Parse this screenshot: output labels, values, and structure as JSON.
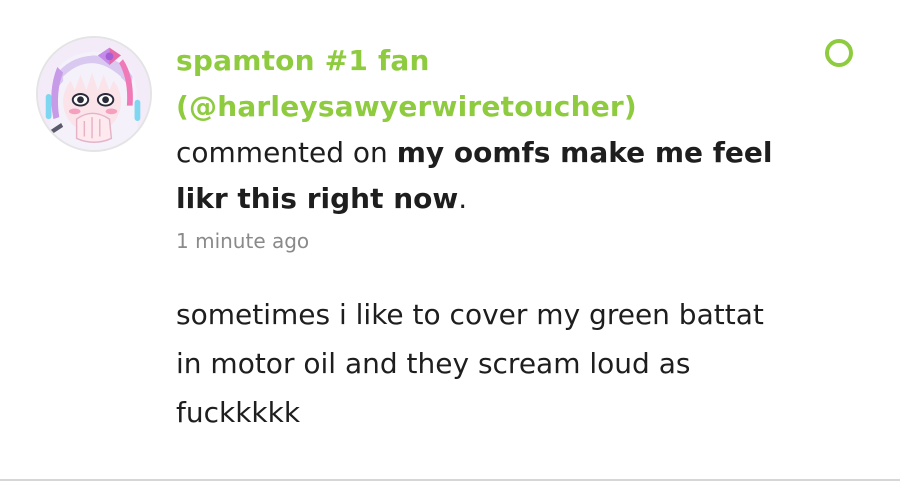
{
  "notification": {
    "author_name": "spamton #1 fan",
    "author_handle": "(@harleysawyerwiretoucher)",
    "action_verb": "commented on",
    "post_title": "my oomfs make me feel likr this right now",
    "period": ".",
    "timestamp": "1 minute ago",
    "comment_body": "sometimes i like to cover my green battat in motor oil and they scream loud as fuckkkkk",
    "unread": true
  },
  "colors": {
    "accent": "#8ecb3f",
    "text": "#1e1e1e",
    "muted": "#8a8a8a"
  }
}
